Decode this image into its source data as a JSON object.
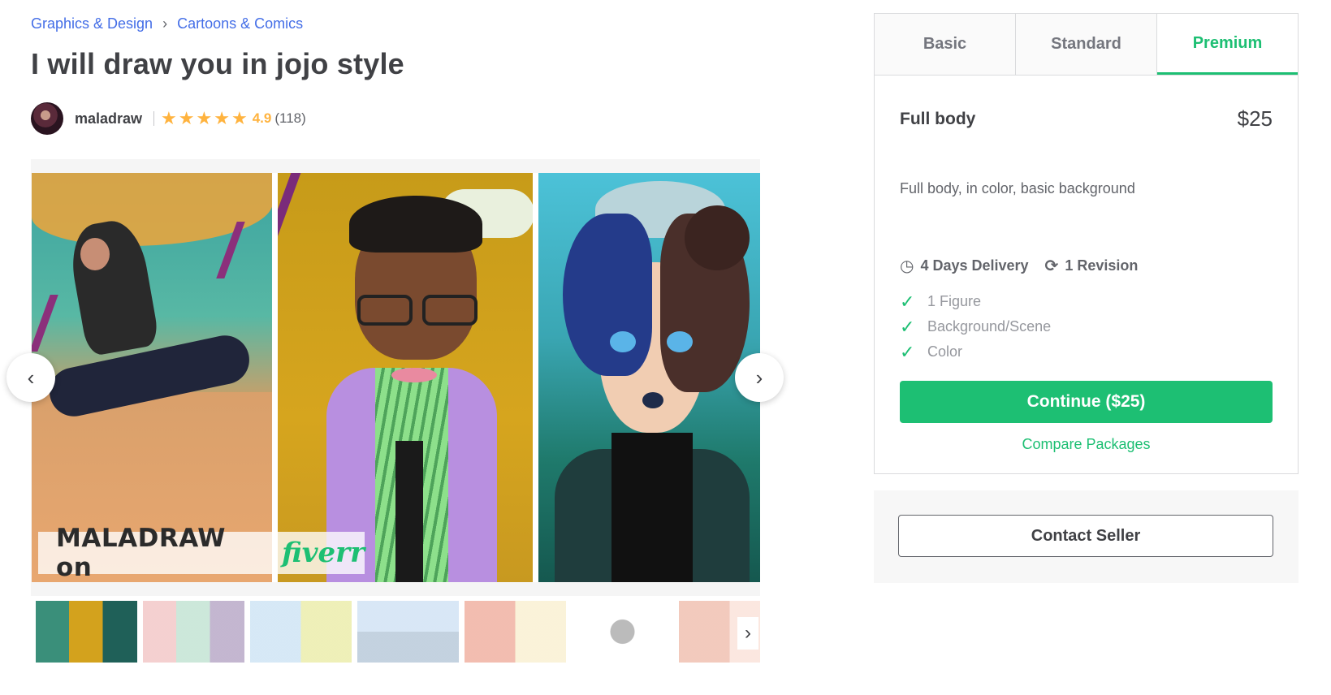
{
  "breadcrumb": {
    "items": [
      "Graphics & Design",
      "Cartoons & Comics"
    ],
    "separator": "›"
  },
  "gig": {
    "title": "I will draw you in jojo style"
  },
  "seller": {
    "name": "maladraw",
    "rating": "4.9",
    "review_count": "(118)",
    "stars": 5
  },
  "gallery": {
    "watermark_left": "MALADRAW on",
    "watermark_brand": "fiverr",
    "thumb_count": 7,
    "prev_icon": "‹",
    "next_icon": "›"
  },
  "packages": {
    "tabs": [
      "Basic",
      "Standard",
      "Premium"
    ],
    "active_tab": "Premium",
    "name": "Full body",
    "price": "$25",
    "description": "Full body, in color, basic background",
    "delivery": "4 Days Delivery",
    "revisions": "1 Revision",
    "features": [
      "1 Figure",
      "Background/Scene",
      "Color"
    ],
    "cta": "Continue ($25)",
    "compare": "Compare Packages"
  },
  "contact": {
    "label": "Contact Seller"
  },
  "colors": {
    "accent": "#1dbf73",
    "link": "#446ee7",
    "star": "#ffb33e"
  }
}
